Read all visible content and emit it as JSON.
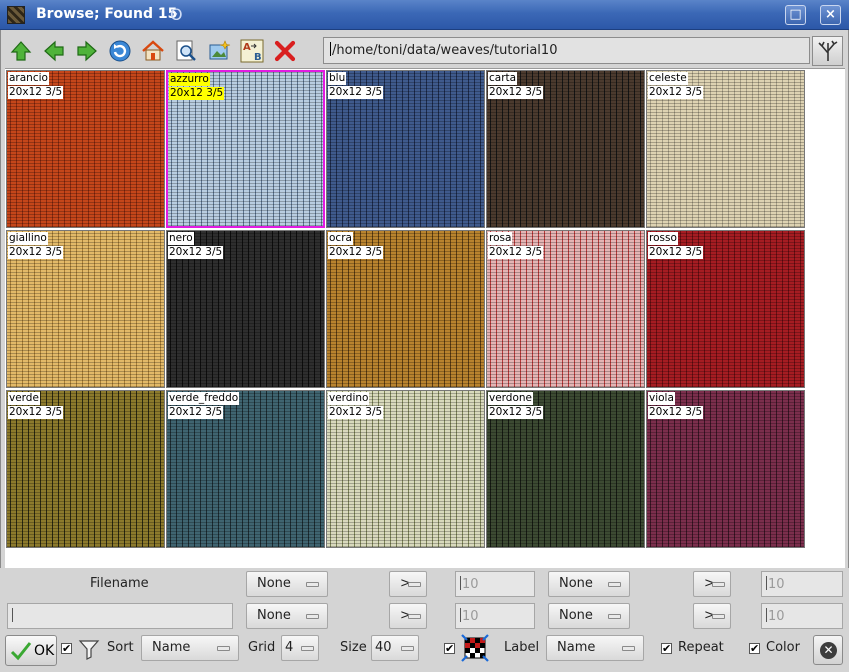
{
  "window": {
    "title": "Browse; Found 15",
    "maximize_label": "□",
    "close_label": "×"
  },
  "toolbar": {
    "path": "/home/toni/data/weaves/tutorial10",
    "buttons": [
      "up-arrow-icon",
      "back-arrow-icon",
      "forward-arrow-icon",
      "refresh-icon",
      "home-icon",
      "zoom-preview-icon",
      "new-image-icon",
      "rename-icon",
      "delete-icon"
    ]
  },
  "swatches": [
    {
      "name": "arancio",
      "info": "20x12 3/5",
      "colors": [
        "#c4461a",
        "#8a2a10"
      ]
    },
    {
      "name": "azzurro",
      "info": "20x12 3/5",
      "colors": [
        "#b9cde0",
        "#5e7590"
      ],
      "selected": true
    },
    {
      "name": "blu",
      "info": "20x12 3/5",
      "colors": [
        "#3f5a8c",
        "#1d2b4c"
      ]
    },
    {
      "name": "carta",
      "info": "20x12 3/5",
      "colors": [
        "#4b3a2e",
        "#151515"
      ]
    },
    {
      "name": "celeste",
      "info": "20x12 3/5",
      "colors": [
        "#ddd2b2",
        "#a8a088"
      ]
    },
    {
      "name": "giallino",
      "info": "20x12 3/5",
      "colors": [
        "#e2b968",
        "#a87f38"
      ]
    },
    {
      "name": "nero",
      "info": "20x12 3/5",
      "colors": [
        "#2e2e2e",
        "#0d0d0d"
      ]
    },
    {
      "name": "ocra",
      "info": "20x12 3/5",
      "colors": [
        "#b9832e",
        "#5e3e12"
      ]
    },
    {
      "name": "rosa",
      "info": "20x12 3/5",
      "colors": [
        "#e4b4b4",
        "#b73a3a"
      ]
    },
    {
      "name": "rosso",
      "info": "20x12 3/5",
      "colors": [
        "#a51c22",
        "#6a0e12"
      ]
    },
    {
      "name": "verde",
      "info": "20x12 3/5",
      "colors": [
        "#8c7a2c",
        "#2a2810"
      ]
    },
    {
      "name": "verde_freddo",
      "info": "20x12 3/5",
      "colors": [
        "#3f6470",
        "#1c2c32"
      ]
    },
    {
      "name": "verdino",
      "info": "20x12 3/5",
      "colors": [
        "#d8d9bc",
        "#7d8458"
      ]
    },
    {
      "name": "verdone",
      "info": "20x12 3/5",
      "colors": [
        "#3c4a32",
        "#151a12"
      ]
    },
    {
      "name": "viola",
      "info": "20x12 3/5",
      "colors": [
        "#7b2e4c",
        "#3a1424"
      ]
    }
  ],
  "filters": {
    "filename_label": "Filename",
    "row1": {
      "combo1": "None",
      "op1": ">",
      "value1": "10",
      "combo2": "None",
      "op2": ">",
      "value2": "10"
    },
    "row2": {
      "combo1": "None",
      "op1": ">",
      "value1": "10",
      "combo2": "None",
      "op2": ">",
      "value2": "10"
    }
  },
  "bottom_bar": {
    "ok_label": "OK",
    "sort_label": "Sort",
    "sort_value": "Name",
    "grid_label": "Grid",
    "grid_value": "4",
    "size_label": "Size",
    "size_value": "40",
    "label_label": "Label",
    "label_value": "Name",
    "repeat_label": "Repeat",
    "color_label": "Color",
    "check_mark": "✔"
  },
  "colors": {
    "titlebar": "#3b68b6",
    "selection": "#e21ae2",
    "highlight": "#ffff00"
  }
}
